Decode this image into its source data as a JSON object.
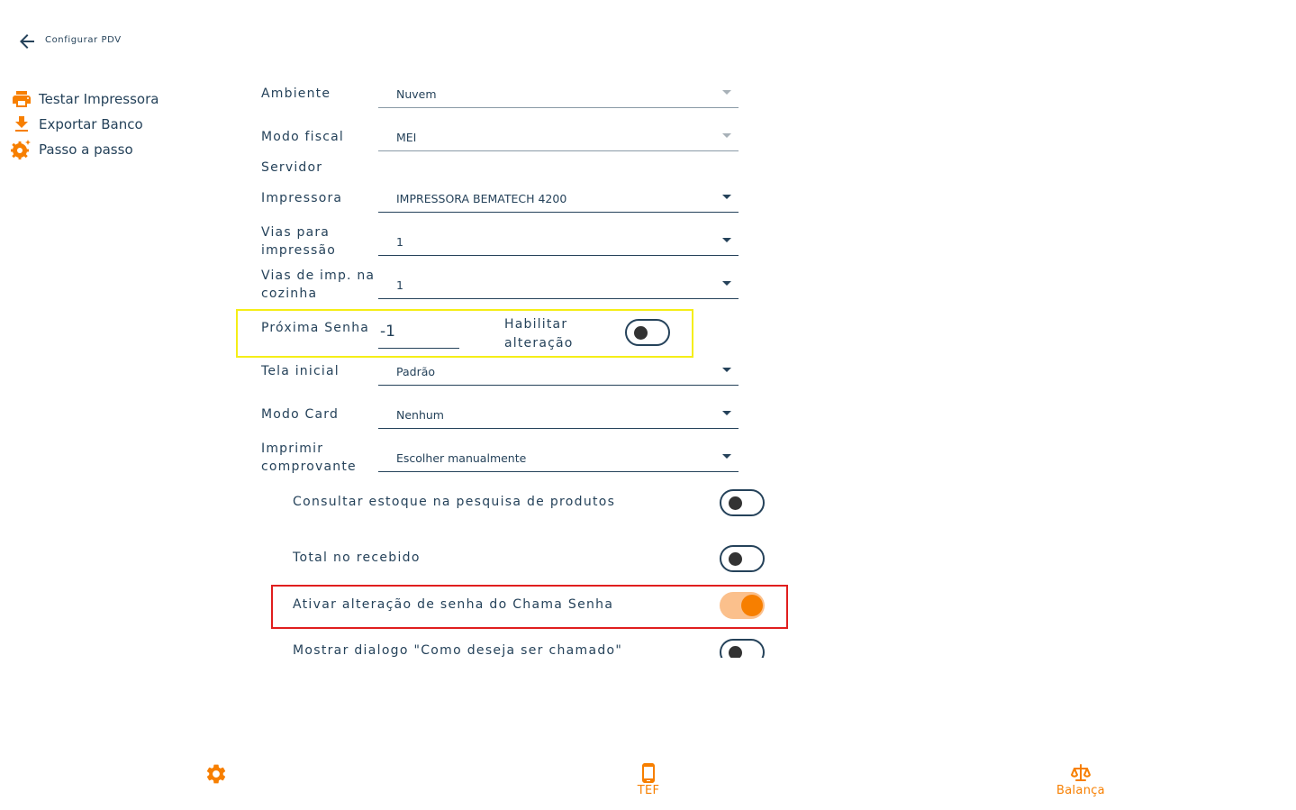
{
  "header": {
    "title": "Configurar PDV",
    "back_icon": "arrow-left-icon"
  },
  "sidebar": {
    "items": [
      {
        "label": "Testar Impressora",
        "icon": "printer-icon"
      },
      {
        "label": "Exportar Banco",
        "icon": "download-icon"
      },
      {
        "label": "Passo a passo",
        "icon": "gear-sparkle-icon"
      }
    ]
  },
  "form": {
    "ambiente": {
      "label": "Ambiente",
      "value": "Nuvem",
      "enabled": false
    },
    "modo_fiscal": {
      "label": "Modo fiscal",
      "value": "MEI",
      "enabled": false
    },
    "servidor": {
      "label": "Servidor"
    },
    "impressora": {
      "label": "Impressora",
      "value": "IMPRESSORA BEMATECH 4200"
    },
    "vias_impressao": {
      "label": "Vias para impressão",
      "value": "1"
    },
    "vias_cozinha": {
      "label": "Vias de imp. na cozinha",
      "value": "1"
    },
    "proxima_senha": {
      "label": "Próxima Senha",
      "value": "-1"
    },
    "habilitar_alteracao": {
      "label": "Habilitar alteração",
      "on": false
    },
    "tela_inicial": {
      "label": "Tela inicial",
      "value": "Padrão"
    },
    "modo_card": {
      "label": "Modo Card",
      "value": "Nenhum"
    },
    "imprimir_comprovante": {
      "label": "Imprimir comprovante",
      "value": "Escolher manualmente"
    }
  },
  "switches": [
    {
      "label": "Consultar estoque na pesquisa de produtos",
      "on": false
    },
    {
      "label": "Total no recebido",
      "on": false
    },
    {
      "label": "Ativar alteração de senha do Chama Senha",
      "on": true
    },
    {
      "label": "Mostrar dialogo \"Como deseja ser chamado\"",
      "on": false
    }
  ],
  "bottom_nav": [
    {
      "label": "",
      "icon": "gear-icon"
    },
    {
      "label": "TEF",
      "icon": "tablet-icon"
    },
    {
      "label": "Balança",
      "icon": "scale-icon"
    }
  ],
  "colors": {
    "accent": "#f77f00",
    "text": "#25425a",
    "toggle_on_track": "#fbc08c",
    "highlight_yellow": "#f5ee17",
    "highlight_red": "#e01e1e"
  }
}
